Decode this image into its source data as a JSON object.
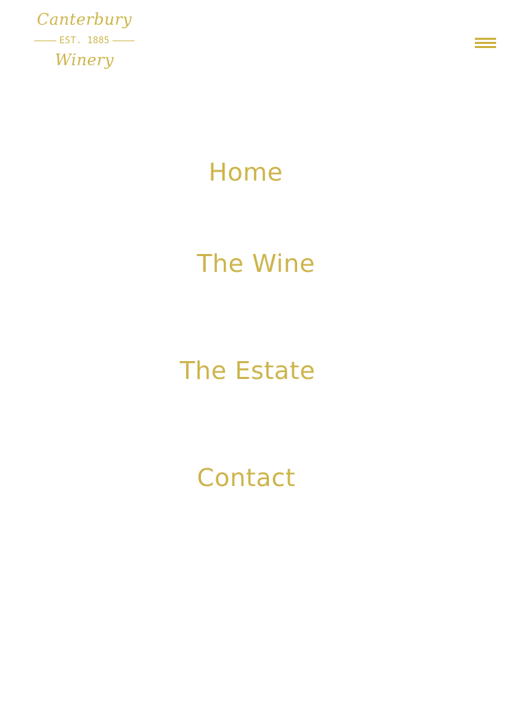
{
  "brand": {
    "script_top": "Canterbury",
    "established": "EST. 1885",
    "script_bottom": "Winery",
    "color": "#c9b23f"
  },
  "header": {
    "menu_icon": "hamburger-menu-icon"
  },
  "nav": {
    "items": [
      {
        "label": "Home"
      },
      {
        "label": "The Wine"
      },
      {
        "label": "The Estate"
      },
      {
        "label": "Contact"
      }
    ]
  }
}
